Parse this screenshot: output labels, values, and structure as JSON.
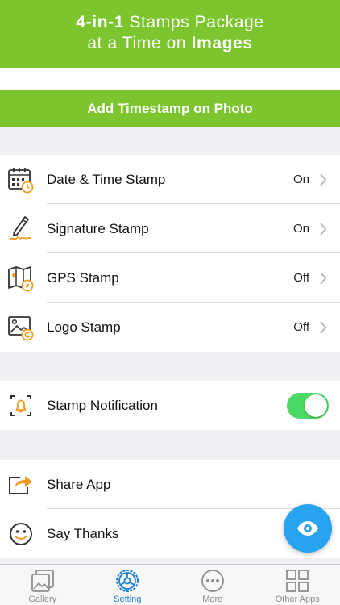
{
  "banner": {
    "line1_bold": "4-in-1",
    "line1_rest": " Stamps Package",
    "line2_rest": "at a Time on ",
    "line2_bold": "Images"
  },
  "action_bar": {
    "label": "Add Timestamp on Photo"
  },
  "stamps": [
    {
      "label": "Date & Time Stamp",
      "value": "On",
      "icon": "calendar-clock-icon"
    },
    {
      "label": "Signature Stamp",
      "value": "On",
      "icon": "pen-signature-icon"
    },
    {
      "label": "GPS Stamp",
      "value": "Off",
      "icon": "map-compass-icon"
    },
    {
      "label": "Logo Stamp",
      "value": "Off",
      "icon": "image-copyright-icon"
    }
  ],
  "notification": {
    "label": "Stamp Notification",
    "enabled": true,
    "icon": "bell-icon"
  },
  "extras": [
    {
      "label": "Share App",
      "icon": "share-icon"
    },
    {
      "label": "Say Thanks",
      "icon": "smiley-icon"
    }
  ],
  "fab": {
    "icon": "eye-icon"
  },
  "tabs": [
    {
      "label": "Gallery",
      "icon": "gallery-icon",
      "active": false
    },
    {
      "label": "Setting",
      "icon": "settings-wheel-icon",
      "active": true
    },
    {
      "label": "More",
      "icon": "more-dots-icon",
      "active": false
    },
    {
      "label": "Other Apps",
      "icon": "grid-apps-icon",
      "active": false
    }
  ],
  "colors": {
    "brand_green": "#7cc52e",
    "accent_orange": "#f39a1e",
    "toggle_on": "#4cd964",
    "fab_blue": "#27a3ef",
    "tab_active": "#1c7fd6"
  }
}
